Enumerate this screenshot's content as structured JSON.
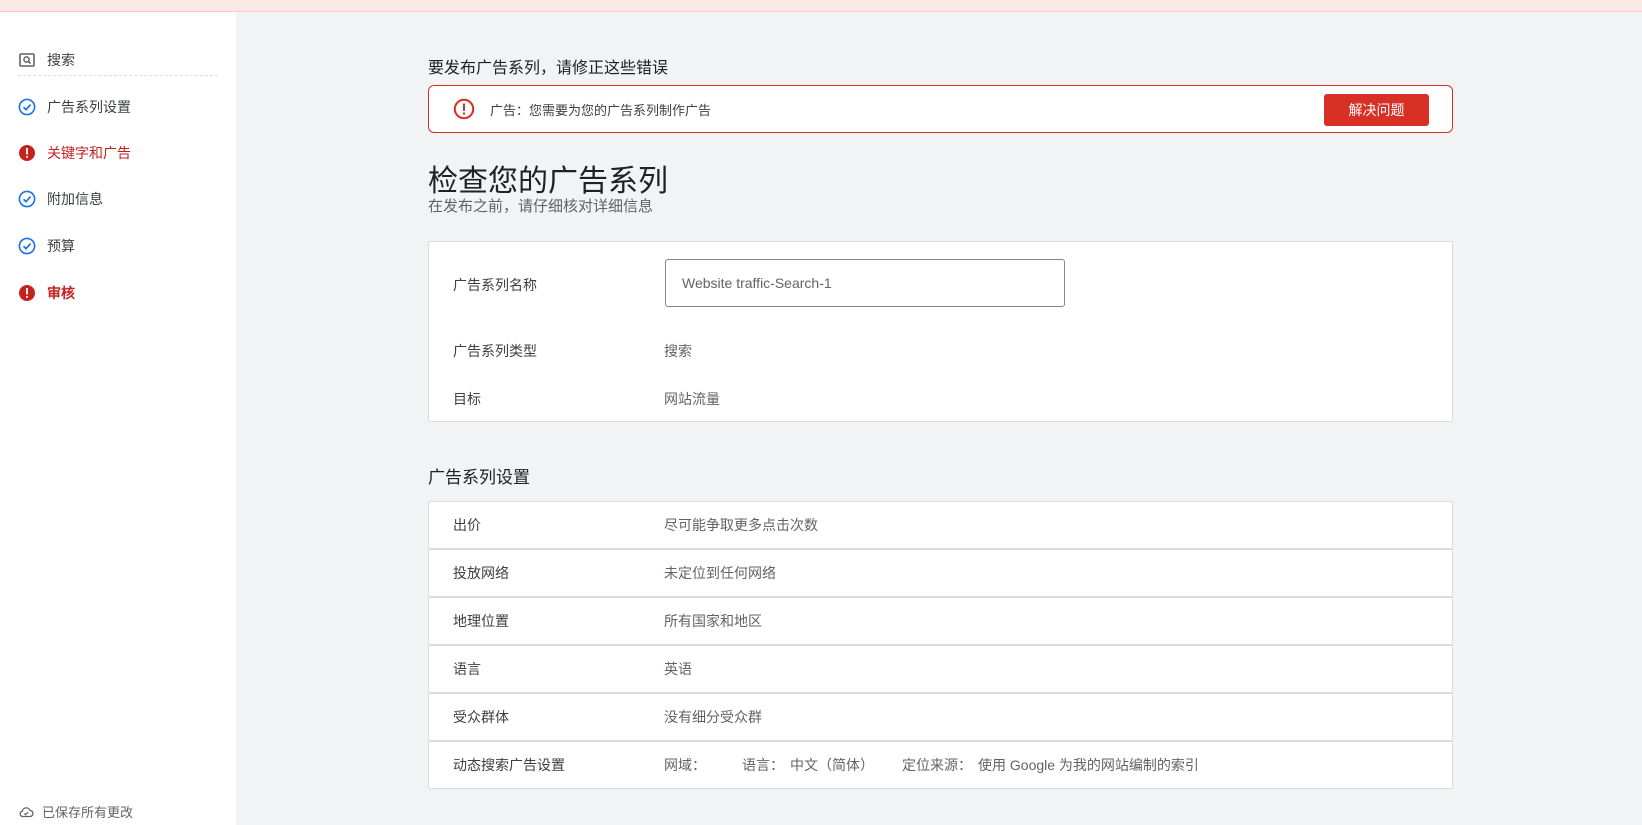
{
  "sidebar": {
    "items": [
      {
        "label": "搜索",
        "status": "search"
      },
      {
        "label": "广告系列设置",
        "status": "complete"
      },
      {
        "label": "关键字和广告",
        "status": "error"
      },
      {
        "label": "附加信息",
        "status": "complete"
      },
      {
        "label": "预算",
        "status": "complete"
      },
      {
        "label": "审核",
        "status": "error"
      }
    ],
    "saved_status": "已保存所有更改"
  },
  "errors": {
    "heading": "要发布广告系列，请修正这些错误",
    "message": "广告：您需要为您的广告系列制作广告",
    "fix_label": "解决问题"
  },
  "review": {
    "title": "检查您的广告系列",
    "subtitle": "在发布之前，请仔细核对详细信息",
    "name_label": "广告系列名称",
    "name_value": "Website traffic-Search-1",
    "type_label": "广告系列类型",
    "type_value": "搜索",
    "goal_label": "目标",
    "goal_value": "网站流量"
  },
  "settings": {
    "title": "广告系列设置",
    "rows": [
      {
        "label": "出价",
        "value": "尽可能争取更多点击次数"
      },
      {
        "label": "投放网络",
        "value": "未定位到任何网络"
      },
      {
        "label": "地理位置",
        "value": "所有国家和地区"
      },
      {
        "label": "语言",
        "value": "英语"
      },
      {
        "label": "受众群体",
        "value": "没有细分受众群"
      }
    ],
    "dsa": {
      "label": "动态搜索广告设置",
      "domain_label": "网域：",
      "language_label": "语言：",
      "language_value": "中文（简体）",
      "source_label": "定位来源：",
      "source_value": "使用 Google 为我的网站编制的索引"
    }
  },
  "colors": {
    "error": "#d93025",
    "complete": "#1a73e8"
  }
}
